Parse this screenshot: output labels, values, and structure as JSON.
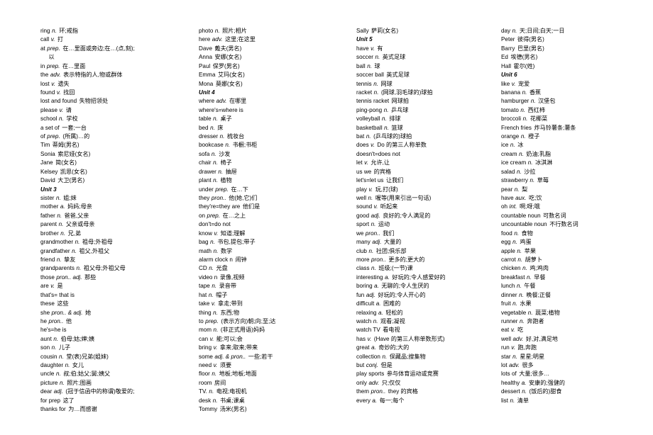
{
  "document": {
    "title": "English Vocabulary List — Units 3-6",
    "page_background": "#ffffff",
    "text_color": "#000000"
  },
  "columns": [
    {
      "id": "col-1",
      "entries": [
        {
          "word": "ring",
          "pos": "n.",
          "def": "环;戒指"
        },
        {
          "word": "call",
          "pos": "v.",
          "def": "打"
        },
        {
          "word": "at",
          "pos": "prep.",
          "def": "在…里面或旁边;在…(点,刻);"
        },
        {
          "word": "",
          "pos": "",
          "def": "以",
          "cont": true
        },
        {
          "word": "in",
          "pos": "prep.",
          "def": "在…里面"
        },
        {
          "word": "the",
          "pos": "adv.",
          "def": "表示特指的人,物或群体"
        },
        {
          "word": "lost",
          "pos": "v.",
          "def": "遗失"
        },
        {
          "word": "found",
          "pos": "v.",
          "def": "找回"
        },
        {
          "word": "lost and found",
          "pos": "",
          "def": "失物招领处"
        },
        {
          "word": "please",
          "pos": "v.",
          "def": "请"
        },
        {
          "word": "school",
          "pos": "n.",
          "def": "学校"
        },
        {
          "word": "a set of",
          "pos": "",
          "def": "一套;一台"
        },
        {
          "word": "of",
          "pos": "prep.",
          "def": "(所属)…的"
        },
        {
          "word": "Tim",
          "pos": "",
          "def": "蒂姆(男名)"
        },
        {
          "word": "Sonia",
          "pos": "",
          "def": "索尼娅(女名)"
        },
        {
          "word": "Jane",
          "pos": "",
          "def": "简(女名)"
        },
        {
          "word": "Kelsey",
          "pos": "",
          "def": "凯思(女名)"
        },
        {
          "word": "David",
          "pos": "",
          "def": "大卫(男名)"
        },
        {
          "unit": "Unit 3"
        },
        {
          "word": "sister",
          "pos": "n.",
          "def": "姐;妹"
        },
        {
          "word": "mother",
          "pos": "a.",
          "def": "妈妈;母亲"
        },
        {
          "word": "father",
          "pos": "n.",
          "def": "爸爸,父亲"
        },
        {
          "word": "parent",
          "pos": "n.",
          "def": "父亲或母亲"
        },
        {
          "word": "brother",
          "pos": "n.",
          "def": "兄,弟"
        },
        {
          "word": "grandmother",
          "pos": "n.",
          "def": "祖母;外祖母"
        },
        {
          "word": "grandfather",
          "pos": "n.",
          "def": "祖父,外祖父"
        },
        {
          "word": "friend",
          "pos": "n.",
          "def": "挚友"
        },
        {
          "word": "grandparents",
          "pos": "n.",
          "def": "祖父母;外祖父母"
        },
        {
          "word": "those",
          "pos": "pron.. adj.",
          "def": "那些"
        },
        {
          "word": "are",
          "pos": "v.",
          "def": "是"
        },
        {
          "word": "that's= that is",
          "pos": "",
          "def": ""
        },
        {
          "word": "these",
          "pos": "",
          "def": "这些"
        },
        {
          "word": "she",
          "pos": "pron.. & adj.",
          "def": "她"
        },
        {
          "word": "he",
          "pos": "pron..",
          "def": "他"
        },
        {
          "word": "he's=he is",
          "pos": "",
          "def": ""
        },
        {
          "word": "aunt",
          "pos": "n.",
          "def": "伯母;姑;婶;姨"
        },
        {
          "word": "son",
          "pos": "n.",
          "def": "儿子"
        },
        {
          "word": "cousin",
          "pos": "n.",
          "def": "堂(表)兄弟(姐妹)"
        },
        {
          "word": "daughter",
          "pos": "n.",
          "def": "女儿"
        },
        {
          "word": "uncle",
          "pos": "n.",
          "def": "叔;伯;姑父;舅;姨父"
        },
        {
          "word": "picture",
          "pos": "n.",
          "def": "照片;图画"
        },
        {
          "word": "dear",
          "pos": "adj.",
          "def": "(冠于信函中的称谓)敬爱的;"
        },
        {
          "word": "for prep",
          "pos": "",
          "def": "这了"
        },
        {
          "word": "thanks for",
          "pos": "",
          "def": "为…而感谢"
        }
      ]
    },
    {
      "id": "col-2",
      "entries": [
        {
          "word": "photo",
          "pos": "n.",
          "def": "照片;相片"
        },
        {
          "word": "here",
          "pos": "adv.",
          "def": "这里;在这里"
        },
        {
          "word": "Dave",
          "pos": "",
          "def": "戴夫(男名)"
        },
        {
          "word": "Anna",
          "pos": "",
          "def": "安娜(女名)"
        },
        {
          "word": "Paul",
          "pos": "",
          "def": "保罗(男名)"
        },
        {
          "word": "Emma",
          "pos": "",
          "def": "艾玛(女名)"
        },
        {
          "word": "Mona",
          "pos": "",
          "def": "莫娜(女名)"
        },
        {
          "unit": "Unit 4"
        },
        {
          "word": "where",
          "pos": "adv.",
          "def": "在哪里"
        },
        {
          "word": "where's=where is",
          "pos": "",
          "def": ""
        },
        {
          "word": "table",
          "pos": "n.",
          "def": "桌子"
        },
        {
          "word": "bed",
          "pos": "n.",
          "def": "床"
        },
        {
          "word": "dresser",
          "pos": "n.",
          "def": "梳妆台"
        },
        {
          "word": "bookcase",
          "pos": "n.",
          "def": "书橱;书柜"
        },
        {
          "word": "sofa",
          "pos": "n.",
          "def": "沙发"
        },
        {
          "word": "chair",
          "pos": "n.",
          "def": "椅子"
        },
        {
          "word": "drawer",
          "pos": "n.",
          "def": "抽屉"
        },
        {
          "word": "plant",
          "pos": "n.",
          "def": "植物"
        },
        {
          "word": "under",
          "pos": "prep.",
          "def": "在…下"
        },
        {
          "word": "they",
          "pos": "pron..",
          "def": "他(她,它)们"
        },
        {
          "word": "they're=they are",
          "pos": "",
          "def": "他们是"
        },
        {
          "word": "on",
          "pos": "prep.",
          "def": "在…之上"
        },
        {
          "word": "don't=do not",
          "pos": "",
          "def": ""
        },
        {
          "word": "know",
          "pos": "v.",
          "def": "知道;理解"
        },
        {
          "word": "bag",
          "pos": "n.",
          "def": "书包,提包;带子"
        },
        {
          "word": "math",
          "pos": "n.",
          "def": "数学"
        },
        {
          "word": "alarm clock n",
          "pos": "",
          "def": "闹钟"
        },
        {
          "word": "CD",
          "pos": "n.",
          "def": "光盘"
        },
        {
          "word": "video n",
          "pos": "",
          "def": "录像,视频"
        },
        {
          "word": "tape",
          "pos": "n.",
          "def": "录音带"
        },
        {
          "word": "hat",
          "pos": "n.",
          "def": "帽子"
        },
        {
          "word": "take",
          "pos": "v.",
          "def": "拿走;带到"
        },
        {
          "word": "thing",
          "pos": "n.",
          "def": "东西;物"
        },
        {
          "word": "to",
          "pos": "prep.",
          "def": "(表示方向)朝;向;至;达"
        },
        {
          "word": "mom",
          "pos": "n.",
          "def": "(非正式用语)妈妈"
        },
        {
          "word": "can",
          "pos": "v.",
          "def": "能;可以;会"
        },
        {
          "word": "bring",
          "pos": "v.",
          "def": "拿来;取来;带来"
        },
        {
          "word": "some",
          "pos": "adj. & pron..",
          "def": "一些;若干"
        },
        {
          "word": "need",
          "pos": "v.",
          "def": "须要"
        },
        {
          "word": "floor",
          "pos": "n.",
          "def": "地板;地板;地面"
        },
        {
          "word": "room",
          "pos": "",
          "def": "房间"
        },
        {
          "word": "TV.",
          "pos": "n.",
          "def": "电视;电视机"
        },
        {
          "word": "desk",
          "pos": "n.",
          "def": "书桌;课桌"
        },
        {
          "word": "Tommy",
          "pos": "",
          "def": "汤米(男名)"
        }
      ]
    },
    {
      "id": "col-3",
      "entries": [
        {
          "word": "Sally",
          "pos": "",
          "def": "萨莉(女名)"
        },
        {
          "unit": "Unit 5"
        },
        {
          "word": "have",
          "pos": "v.",
          "def": "有"
        },
        {
          "word": "soccer",
          "pos": "n.",
          "def": "英式足球"
        },
        {
          "word": "ball",
          "pos": "n.",
          "def": "球"
        },
        {
          "word": "soccer ball",
          "pos": "",
          "def": "英式足球"
        },
        {
          "word": "tennis",
          "pos": "n.",
          "def": "网球"
        },
        {
          "word": "racket",
          "pos": "n.",
          "def": "(网球,羽毛球的)球拍"
        },
        {
          "word": "tennis racket",
          "pos": "",
          "def": "网球拍"
        },
        {
          "word": "ping-pong",
          "pos": "n.",
          "def": "乒乓球"
        },
        {
          "word": "volleyball",
          "pos": "n.",
          "def": "排球"
        },
        {
          "word": "basketball",
          "pos": "n.",
          "def": "篮球"
        },
        {
          "word": "bat",
          "pos": "n.",
          "def": "(乒乓球的)球拍"
        },
        {
          "word": "does",
          "pos": "v.",
          "def": "Do 的第三人称单数"
        },
        {
          "word": "doesn't=does not",
          "pos": "",
          "def": ""
        },
        {
          "word": "let",
          "pos": "v.",
          "def": "允许,让"
        },
        {
          "word": "us we",
          "pos": "",
          "def": "的宾格"
        },
        {
          "word": "let's=let us",
          "pos": "",
          "def": "让我们"
        },
        {
          "word": "play",
          "pos": "v.",
          "def": "玩,打(球)"
        },
        {
          "word": "well",
          "pos": "n.",
          "def": "喔等(用来引出一句话)"
        },
        {
          "word": "sound",
          "pos": "v.",
          "def": "听起来"
        },
        {
          "word": "good",
          "pos": "adj.",
          "def": "良好的;令人满足的"
        },
        {
          "word": "sport",
          "pos": "n.",
          "def": "运动"
        },
        {
          "word": "we",
          "pos": "pron..",
          "def": "我们"
        },
        {
          "word": "many",
          "pos": "adj.",
          "def": "大量的"
        },
        {
          "word": "club",
          "pos": "n.",
          "def": "社团;俱乐部"
        },
        {
          "word": "more",
          "pos": "pron..",
          "def": "更多的;更大的"
        },
        {
          "word": "class",
          "pos": "n.",
          "def": "班级;(一节)课"
        },
        {
          "word": "interesting",
          "pos": "a.",
          "def": "好玩的;令人感爱好的"
        },
        {
          "word": "boring",
          "pos": "a.",
          "def": "无聊的;令人生厌的"
        },
        {
          "word": "fun",
          "pos": "adj.",
          "def": "好玩的;令人开心的"
        },
        {
          "word": "difficult",
          "pos": "a.",
          "def": "困难的"
        },
        {
          "word": "relaxing",
          "pos": "a.",
          "def": "轻松的"
        },
        {
          "word": "watch",
          "pos": "n.",
          "def": "观看;凝视"
        },
        {
          "word": "watch TV",
          "pos": "",
          "def": "看电视"
        },
        {
          "word": "has",
          "pos": "v.",
          "def": "(Have 的第三人称单数形式)"
        },
        {
          "word": "great",
          "pos": "a.",
          "def": "奇妙的;大的"
        },
        {
          "word": "collection",
          "pos": "n.",
          "def": "保藏品;搜集物"
        },
        {
          "word": "but",
          "pos": "conj.",
          "def": "但是"
        },
        {
          "word": "play sports",
          "pos": "",
          "def": "参与体育运动或竞赛"
        },
        {
          "word": "only",
          "pos": "adv.",
          "def": "只;仅仅"
        },
        {
          "word": "them",
          "pos": "pron..",
          "def": "they 的宾格"
        },
        {
          "word": "every",
          "pos": "a.",
          "def": "每一;每个"
        }
      ]
    },
    {
      "id": "col-4",
      "entries": [
        {
          "word": "day",
          "pos": "n.",
          "def": "天;日间;白天;一日"
        },
        {
          "word": "Peter",
          "pos": "",
          "def": "彼得(男名)"
        },
        {
          "word": "Barry",
          "pos": "",
          "def": "巴里(男名)"
        },
        {
          "word": "Ed",
          "pos": "",
          "def": "埃德(男名)"
        },
        {
          "word": "Hall",
          "pos": "",
          "def": "霍尔(姓)"
        },
        {
          "unit": "Unit 6"
        },
        {
          "word": "like",
          "pos": "v.",
          "def": "宠爱"
        },
        {
          "word": "banana",
          "pos": "n.",
          "def": "香蕉"
        },
        {
          "word": "hamburger",
          "pos": "n.",
          "def": "汉堡包"
        },
        {
          "word": "tomato",
          "pos": "n.",
          "def": "西红柿"
        },
        {
          "word": "broccoli",
          "pos": "n.",
          "def": "花椰菜"
        },
        {
          "word": "French fries",
          "pos": "",
          "def": "炸马铃薯条;薯条"
        },
        {
          "word": "orange",
          "pos": "n.",
          "def": "橙子"
        },
        {
          "word": "ice",
          "pos": "n.",
          "def": "冰"
        },
        {
          "word": "cream",
          "pos": "n.",
          "def": "奶油;乳脂"
        },
        {
          "word": "ice cream",
          "pos": "n.",
          "def": "冰淇淋"
        },
        {
          "word": "salad",
          "pos": "n.",
          "def": "沙拉"
        },
        {
          "word": "strawberry",
          "pos": "n.",
          "def": "草莓"
        },
        {
          "word": "pear",
          "pos": "n.",
          "def": "梨"
        },
        {
          "word": "have",
          "pos": "aux.",
          "def": "吃;饮"
        },
        {
          "word": "oh",
          "pos": "int.",
          "def": "啊;呀;哦"
        },
        {
          "word": "countable noun",
          "pos": "",
          "def": "可数名词"
        },
        {
          "word": "uncountable noun",
          "pos": "",
          "def": "不行数名词"
        },
        {
          "word": "food",
          "pos": "n.",
          "def": "食物"
        },
        {
          "word": "egg",
          "pos": "n.",
          "def": "鸡蛋"
        },
        {
          "word": "apple",
          "pos": "n.",
          "def": "苹果"
        },
        {
          "word": "carrot",
          "pos": "n.",
          "def": "胡萝卜"
        },
        {
          "word": "chicken",
          "pos": "n.",
          "def": "鸡;鸡肉"
        },
        {
          "word": "breakfast",
          "pos": "n.",
          "def": "早餐"
        },
        {
          "word": "lunch",
          "pos": "n.",
          "def": "午餐"
        },
        {
          "word": "dinner",
          "pos": "n.",
          "def": "晚餐;正餐"
        },
        {
          "word": "fruit",
          "pos": "n.",
          "def": "水果"
        },
        {
          "word": "vegetable",
          "pos": "n.",
          "def": "蔬菜;植物"
        },
        {
          "word": "runner",
          "pos": "n.",
          "def": "奔跑者"
        },
        {
          "word": "eat",
          "pos": "v.",
          "def": "吃"
        },
        {
          "word": "well",
          "pos": "adv.",
          "def": "好,对,满足地"
        },
        {
          "word": "run",
          "pos": "v.",
          "def": "跑,奔跑"
        },
        {
          "word": "star",
          "pos": "n.",
          "def": "星星;明星"
        },
        {
          "word": "lot",
          "pos": "adv.",
          "def": "很多"
        },
        {
          "word": "lots of",
          "pos": "",
          "def": "大量;很多…"
        },
        {
          "word": "healthy",
          "pos": "a.",
          "def": "安康的;强健的"
        },
        {
          "word": "dessert",
          "pos": "n.",
          "def": "(饭后的)甜食"
        },
        {
          "word": "list",
          "pos": "n.",
          "def": "清单"
        }
      ]
    }
  ]
}
